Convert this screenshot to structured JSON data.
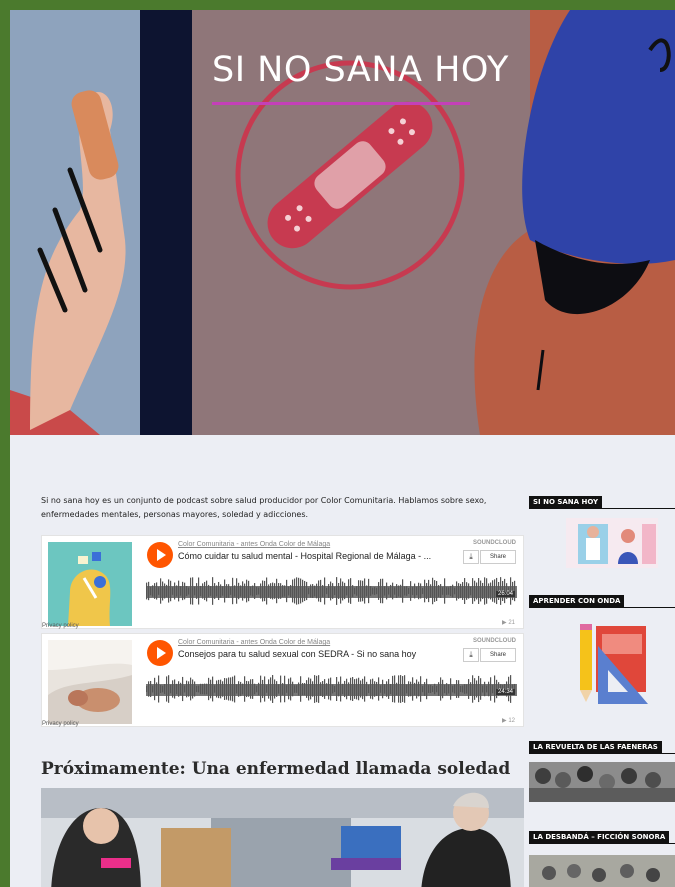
{
  "hero": {
    "title": "SI NO SANA HOY"
  },
  "intro": "Si no sana hoy es un conjunto de podcast sobre salud producidor por Color Comunitaria. Hablamos sobre sexo, enfermedades mentales, personas mayores, soledad y adicciones.",
  "players": [
    {
      "artist": "Color Comunitaria - antes Onda Color de Málaga",
      "track": "Cómo cuidar tu salud mental - Hospital Regional de Málaga - ...",
      "duration": "26:04",
      "plays": "▶ 21",
      "privacy": "Privacy policy",
      "brand": "SOUNDCLOUD",
      "download": "⤓",
      "share": "Share"
    },
    {
      "artist": "Color Comunitaria - antes Onda Color de Málaga",
      "track": "Consejos para tu salud sexual con SEDRA - Si no sana hoy",
      "duration": "24:34",
      "plays": "▶ 12",
      "privacy": "Privacy policy",
      "brand": "SOUNDCLOUD",
      "download": "⤓",
      "share": "Share"
    }
  ],
  "upcoming_heading": "Próximamente: Una enfermedad llamada soledad",
  "sidebar": [
    {
      "title": "SI NO SANA HOY"
    },
    {
      "title": "APRENDER CON ONDA"
    },
    {
      "title": "LA REVUELTA DE LAS FAENERAS"
    },
    {
      "title": "LA DESBANDÁ – FICCIÓN SONORA"
    }
  ],
  "colors": {
    "frame": "#4b7a2d",
    "accent_underline": "#c440b8",
    "soundcloud": "#ff5500",
    "page_bg": "#eceef4"
  }
}
